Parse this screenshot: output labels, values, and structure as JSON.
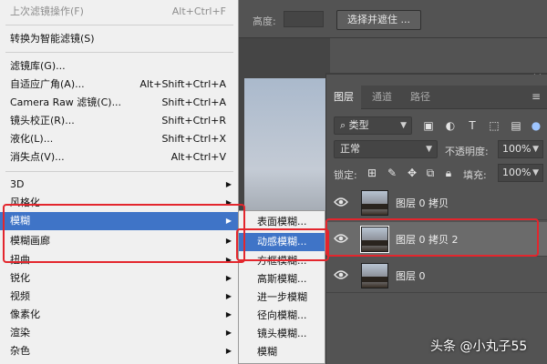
{
  "options_bar": {
    "height_label": "高度:",
    "select_mask_button": "选择并遮住 ..."
  },
  "filter_menu": {
    "items": [
      {
        "label": "上次滤镜操作(F)",
        "shortcut": "Alt+Ctrl+F",
        "disabled": true
      },
      {
        "label": "转换为智能滤镜(S)"
      },
      {
        "label": "滤镜库(G)..."
      },
      {
        "label": "自适应广角(A)...",
        "shortcut": "Alt+Shift+Ctrl+A"
      },
      {
        "label": "Camera Raw 滤镜(C)...",
        "shortcut": "Shift+Ctrl+A"
      },
      {
        "label": "镜头校正(R)...",
        "shortcut": "Shift+Ctrl+R"
      },
      {
        "label": "液化(L)...",
        "shortcut": "Shift+Ctrl+X"
      },
      {
        "label": "消失点(V)...",
        "shortcut": "Alt+Ctrl+V"
      },
      {
        "label": "3D"
      },
      {
        "label": "风格化"
      },
      {
        "label": "模糊"
      },
      {
        "label": "模糊画廊"
      },
      {
        "label": "扭曲"
      },
      {
        "label": "锐化"
      },
      {
        "label": "视频"
      },
      {
        "label": "像素化"
      },
      {
        "label": "渲染"
      },
      {
        "label": "杂色"
      }
    ]
  },
  "blur_submenu": {
    "items": [
      "表面模糊...",
      "动感模糊...",
      "方框模糊...",
      "高斯模糊...",
      "进一步模糊",
      "径向模糊...",
      "镜头模糊...",
      "模糊"
    ]
  },
  "layers_panel": {
    "tabs": [
      "图层",
      "通道",
      "路径"
    ],
    "kind_filter": "类型",
    "blend_mode": "正常",
    "opacity_label": "不透明度:",
    "opacity_value": "100%",
    "lock_label": "锁定:",
    "fill_label": "填充:",
    "fill_value": "100%",
    "layers": [
      {
        "name": "图层 0 拷贝"
      },
      {
        "name": "图层 0 拷贝 2"
      },
      {
        "name": "图层 0"
      }
    ]
  },
  "watermark": "头条 @小丸子55",
  "colors": {
    "highlight": "#3f74c7",
    "annotation": "#e3262d",
    "workspace": "#535353"
  }
}
